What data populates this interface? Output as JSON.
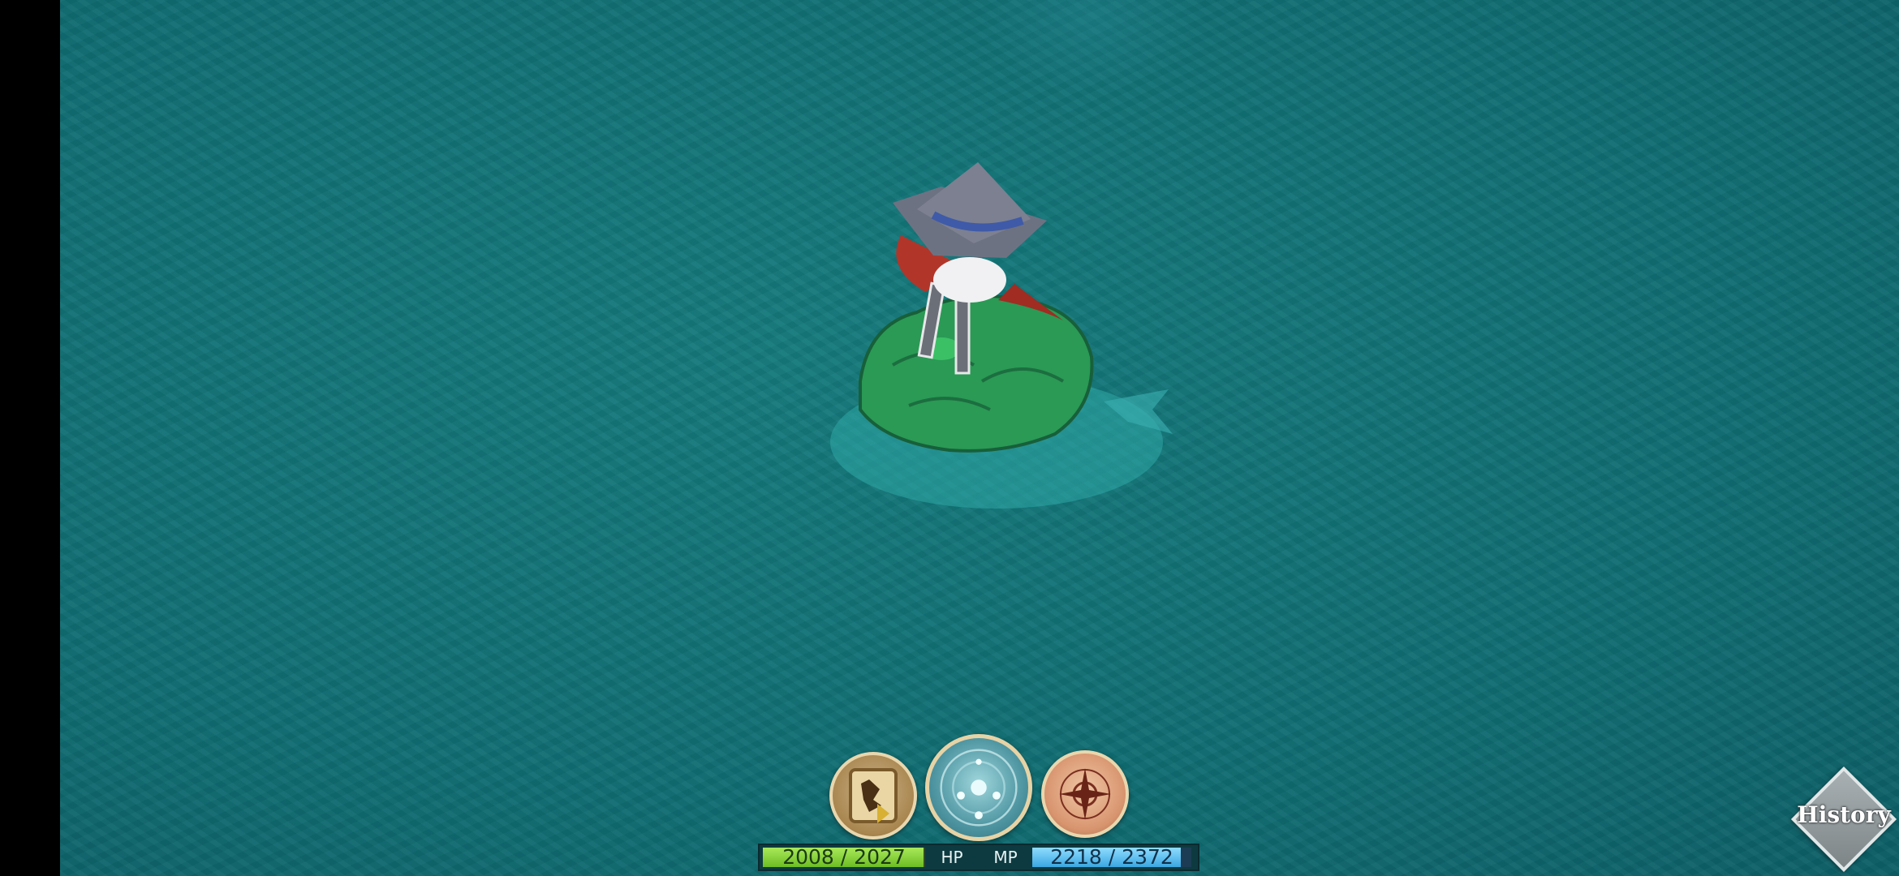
{
  "hud": {
    "hp": {
      "label": "HP",
      "value_text": "2008 / 2027",
      "current": 2008,
      "max": 2027
    },
    "mp": {
      "label": "MP",
      "value_text": "2218 / 2372",
      "current": 2218,
      "max": 2372
    },
    "buttons": [
      {
        "id": "quest",
        "icon": "quest-scroll-icon"
      },
      {
        "id": "skill",
        "icon": "magic-rune-icon"
      },
      {
        "id": "map",
        "icon": "compass-icon"
      }
    ],
    "history_label": "History"
  },
  "colors": {
    "ocean": "#11717a",
    "hp_bar": "#8fd63f",
    "mp_bar": "#5bbde9",
    "frame_gold": "#e9d7ae"
  }
}
